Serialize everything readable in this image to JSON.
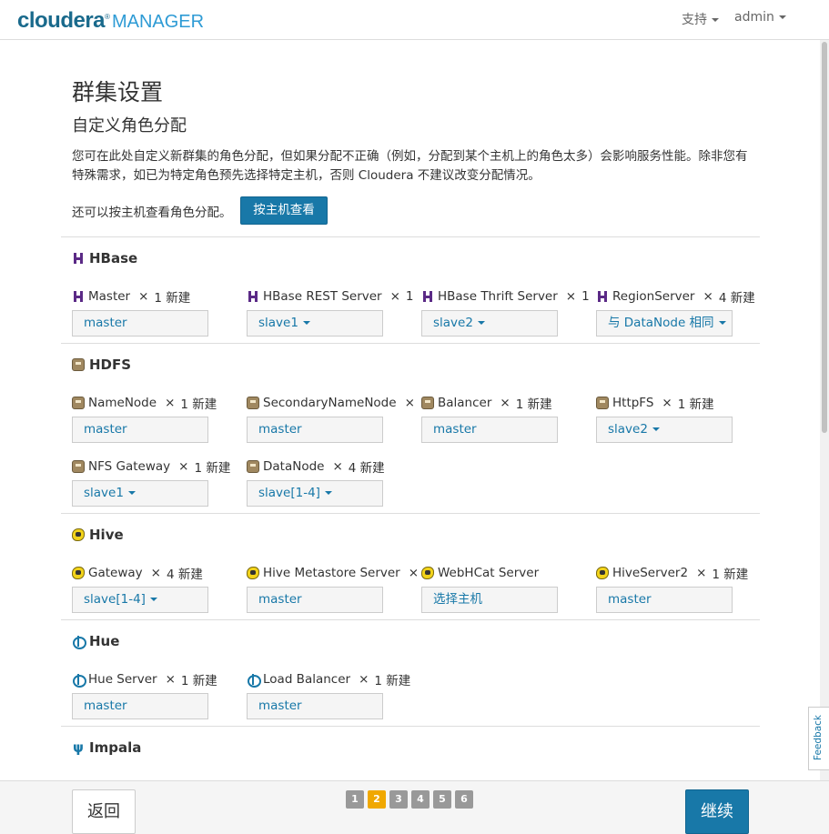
{
  "header": {
    "logo_brand": "cloudera",
    "logo_product": "MANAGER",
    "support_label": "支持",
    "user_label": "admin"
  },
  "page": {
    "title": "群集设置",
    "subtitle": "自定义角色分配",
    "description": "您可在此处自定义新群集的角色分配，但如果分配不正确（例如，分配到某个主机上的角色太多）会影响服务性能。除非您有特殊需求，如已为特定角色预先选择特定主机，否则 Cloudera 不建议改变分配情况。",
    "host_view_text": "还可以按主机查看角色分配。",
    "host_view_button": "按主机查看"
  },
  "services": [
    {
      "name": "HBase",
      "icon": "hbase-icon",
      "roles": [
        {
          "name": "Master",
          "count": "1 新建",
          "host": "master",
          "dropdown": false
        },
        {
          "name": "HBase REST Server",
          "count": "1",
          "host": "slave1",
          "dropdown": true
        },
        {
          "name": "HBase Thrift Server",
          "count": "1",
          "host": "slave2",
          "dropdown": true
        },
        {
          "name": "RegionServer",
          "count": "4 新建",
          "host": "与 DataNode 相同",
          "dropdown": true
        }
      ]
    },
    {
      "name": "HDFS",
      "icon": "hdfs-icon",
      "roles": [
        {
          "name": "NameNode",
          "count": "1 新建",
          "host": "master",
          "dropdown": false
        },
        {
          "name": "SecondaryNameNode",
          "count": "",
          "host": "master",
          "dropdown": false
        },
        {
          "name": "Balancer",
          "count": "1 新建",
          "host": "master",
          "dropdown": false
        },
        {
          "name": "HttpFS",
          "count": "1 新建",
          "host": "slave2",
          "dropdown": true
        },
        {
          "name": "NFS Gateway",
          "count": "1 新建",
          "host": "slave1",
          "dropdown": true
        },
        {
          "name": "DataNode",
          "count": "4 新建",
          "host": "slave[1-4]",
          "dropdown": true
        }
      ]
    },
    {
      "name": "Hive",
      "icon": "hive-icon",
      "roles": [
        {
          "name": "Gateway",
          "count": "4 新建",
          "host": "slave[1-4]",
          "dropdown": true
        },
        {
          "name": "Hive Metastore Server",
          "count": "",
          "host": "master",
          "dropdown": false
        },
        {
          "name": "WebHCat Server",
          "count": null,
          "host": "选择主机",
          "dropdown": false
        },
        {
          "name": "HiveServer2",
          "count": "1 新建",
          "host": "master",
          "dropdown": false
        }
      ]
    },
    {
      "name": "Hue",
      "icon": "hue-icon",
      "roles": [
        {
          "name": "Hue Server",
          "count": "1 新建",
          "host": "master",
          "dropdown": false
        },
        {
          "name": "Load Balancer",
          "count": "1 新建",
          "host": "master",
          "dropdown": false
        }
      ]
    },
    {
      "name": "Impala",
      "icon": "impala-icon",
      "roles": []
    }
  ],
  "footer": {
    "back_label": "返回",
    "next_label": "继续",
    "steps": [
      "1",
      "2",
      "3",
      "4",
      "5",
      "6"
    ],
    "active_step": "2"
  },
  "feedback_label": "Feedback",
  "role_separator": "×"
}
